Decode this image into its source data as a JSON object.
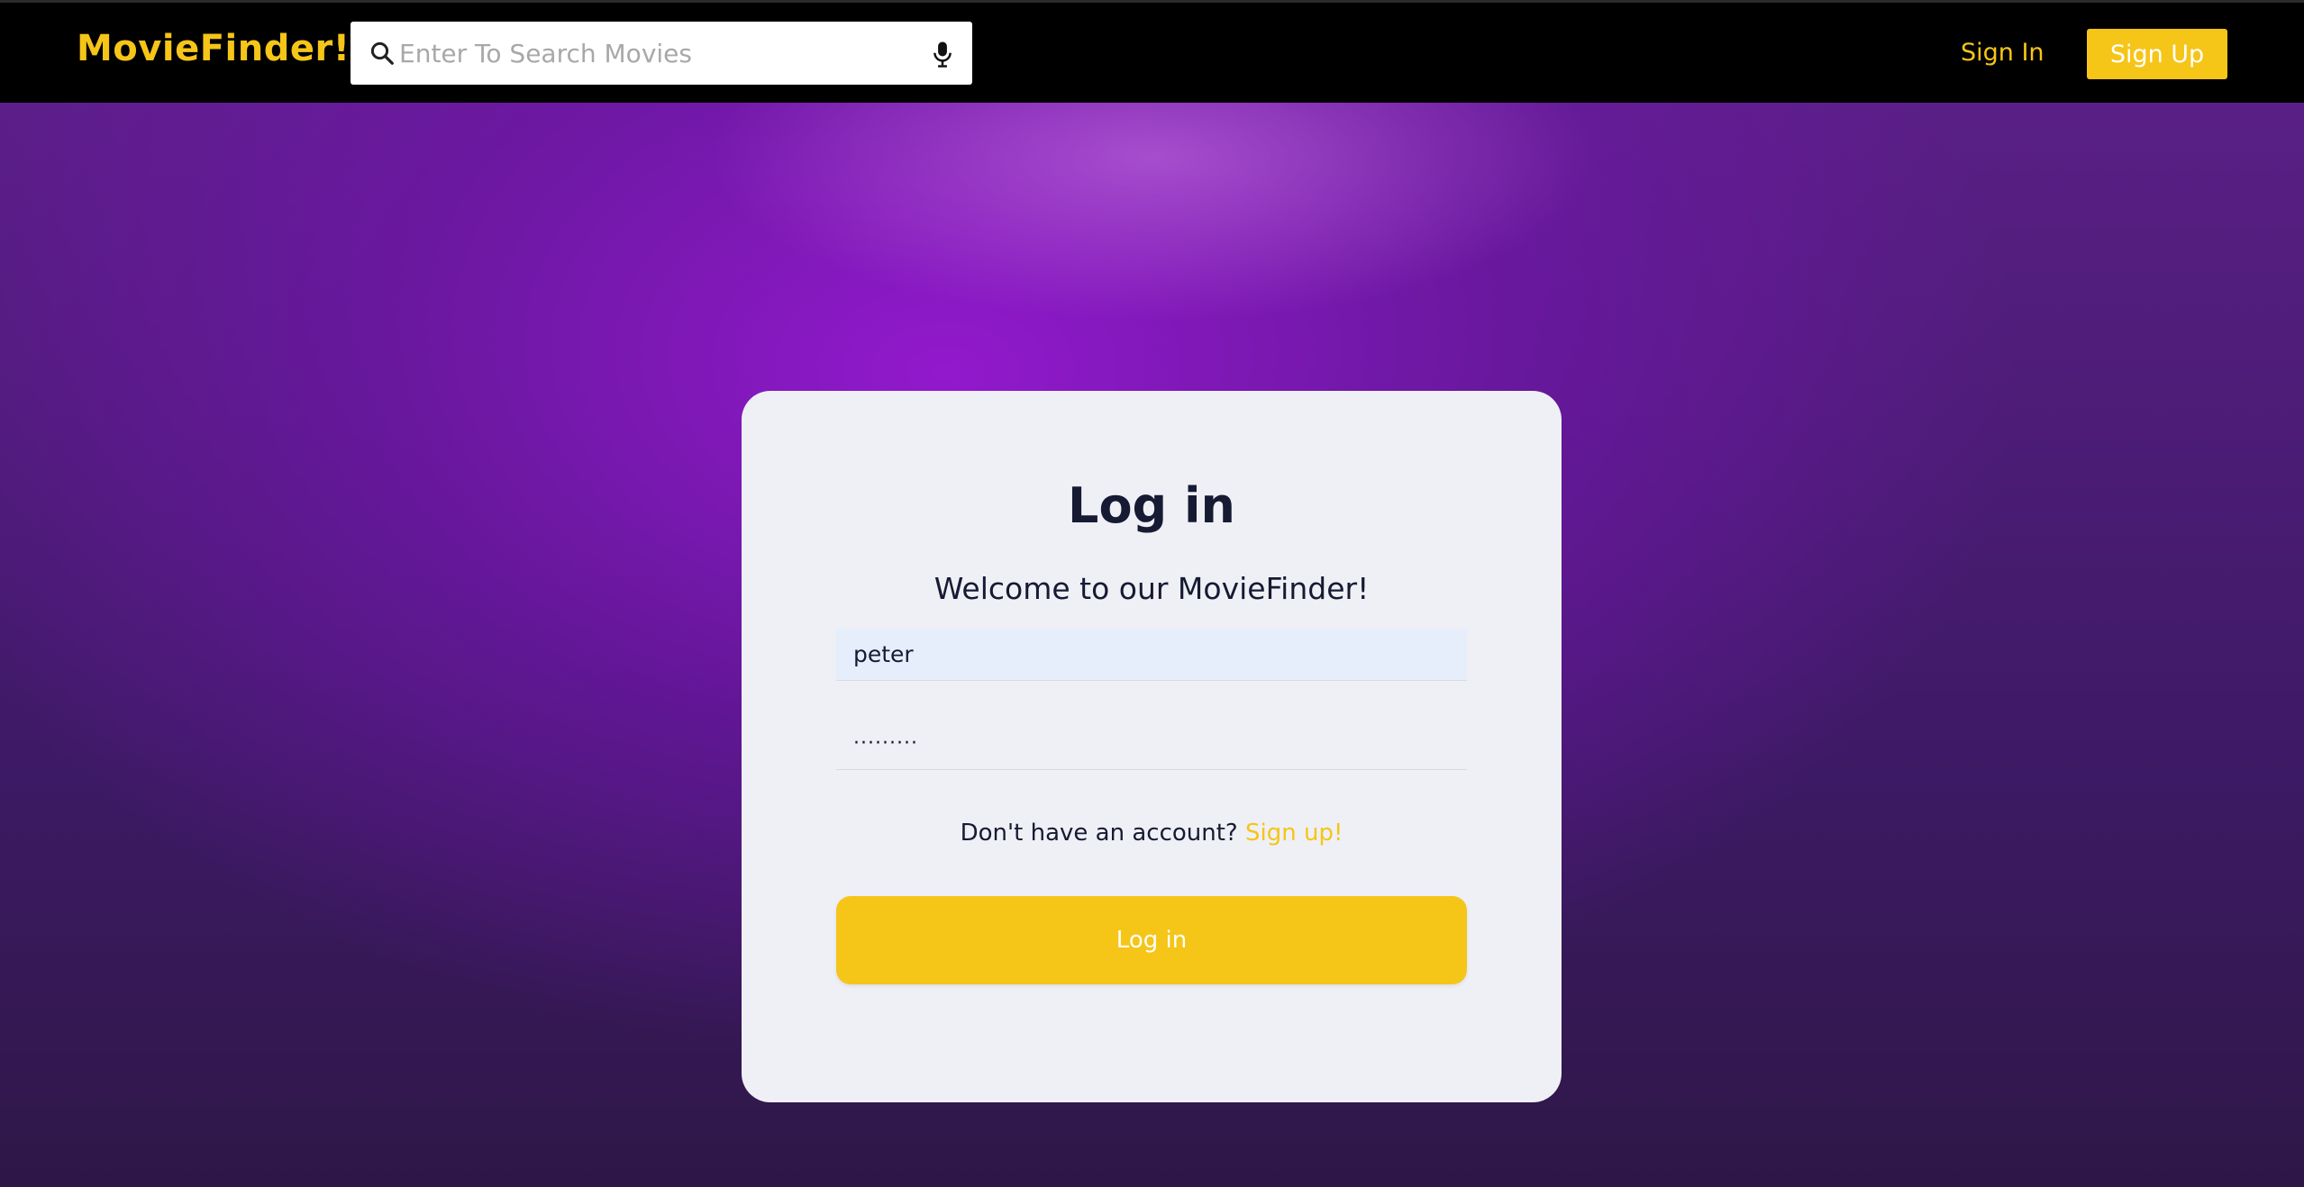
{
  "navbar": {
    "brand": "MovieFinder!",
    "search": {
      "placeholder": "Enter To Search Movies",
      "value": "",
      "search_icon": "search-icon",
      "mic_icon": "microphone-icon"
    },
    "sign_in_label": "Sign In",
    "sign_up_label": "Sign Up"
  },
  "login": {
    "title": "Log in",
    "subtitle": "Welcome to our MovieFinder!",
    "username_value": "peter",
    "password_value": "·········",
    "account_prompt": "Don't have an account?",
    "signup_link": "Sign up!",
    "submit_label": "Log in"
  },
  "colors": {
    "accent": "#f5c518",
    "navbar_bg": "#000000",
    "card_bg": "#eff0f5",
    "text_dark": "#161a33",
    "hero_purple": "#9a1ad6"
  }
}
